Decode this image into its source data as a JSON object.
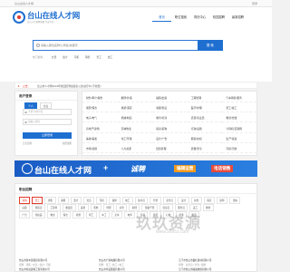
{
  "topbar": {
    "left": "台山在线人才网",
    "right": "登录"
  },
  "header": {
    "logo_text": "台山在线人才网",
    "logo_sub": "台山人才招聘求职 专业平台",
    "nav": [
      "首页",
      "职位搜索",
      "简历中心",
      "校园招聘",
      "最新招聘"
    ]
  },
  "search": {
    "placeholder": "请输入职位名称/公司名/关键字",
    "button": "搜 索",
    "hot_label": "热门搜索：",
    "hot": [
      "文员",
      "会计",
      "司机",
      "销售",
      "普工",
      "技工"
    ]
  },
  "notice": {
    "label": "公告：",
    "text": "台山市人才网2024年校园招聘会报名火热进行中 (不收费)"
  },
  "login": {
    "title": "用户登录",
    "roles": [
      "个人",
      "企业"
    ],
    "username_placeholder": "手机号/用户名",
    "password_placeholder": "请输入密码",
    "button": "立即登录",
    "forgot": "忘记密码",
    "register": "免费注册"
  },
  "categories": [
    [
      "财务/审计/税务",
      "翻译/外语",
      "编辑/出版",
      "工程管理",
      "汽车销售/服务"
    ],
    [
      "保安/保洁",
      "旅游/酒店",
      "客服/售后",
      "医疗/护理",
      "普工/技工"
    ],
    [
      "电子/电气",
      "机械/制造",
      "教育/培训",
      "店员/营业员",
      "物流/仓储"
    ],
    [
      "房地产/建筑",
      "农林牧渔",
      "贸易/采购",
      "行政/后勤",
      "计算机/互联网"
    ],
    [
      "美容/美发",
      "化工/环保",
      "设计/广告",
      "服装/纺织",
      "生产/营运"
    ],
    [
      "市场/营销",
      "人力资源",
      "经营管理",
      "质量/安全",
      "司机/驾驶"
    ]
  ],
  "banner": {
    "title": "台山在线人才网",
    "sub": "WWW.TSZXRC.COM",
    "slogan": "诚聘",
    "tag1": "编辑运营",
    "tag2": "电话销售"
  },
  "jobs": {
    "title": "职业招聘",
    "tag_rows": [
      [
        "采购",
        "普工",
        "销售",
        "客服",
        "会计",
        "文员",
        "司机",
        "跟单",
        "电工",
        "技术员",
        "仓管",
        "业务员",
        "设计",
        "前台",
        "保安",
        "厨师",
        "出纳"
      ],
      [
        "后勤",
        "理货员",
        "工程师",
        "收银员",
        "品管",
        "质检",
        "经理",
        "主管",
        "助理",
        "储备干部",
        "营业员",
        "服务员",
        "美工",
        "教师"
      ],
      [
        "广告",
        "化妆品",
        "物业",
        "保洁",
        "机修",
        "焊工",
        "车工",
        "叉车",
        "电焊",
        "包装",
        "装配",
        "打磨",
        "喷漆",
        "搬运"
      ]
    ],
    "companies": [
      [
        "台山市新丰源贸易有限公司",
        "台山市广源电器有限公司",
        "江门市台山市鑫旺建材有限公司"
      ],
      [
        "招聘：销售 / 文员 / 会计 / 司机",
        "招聘：普工 / 技工 / 电工",
        "招聘：业务员 / 仓管 / 跟单"
      ],
      [
        "台山市恒达建筑工程有限公司",
        "台山市华美服装有限公司",
        "江门市台山市顺发物流有限公司"
      ]
    ]
  },
  "watermark": {
    "main": "玖玖资源",
    "url": "www.9985z.com"
  },
  "colors": {
    "brand": "#1f6fd1",
    "accent": "#e23b2e",
    "orange": "#f29a1d"
  }
}
